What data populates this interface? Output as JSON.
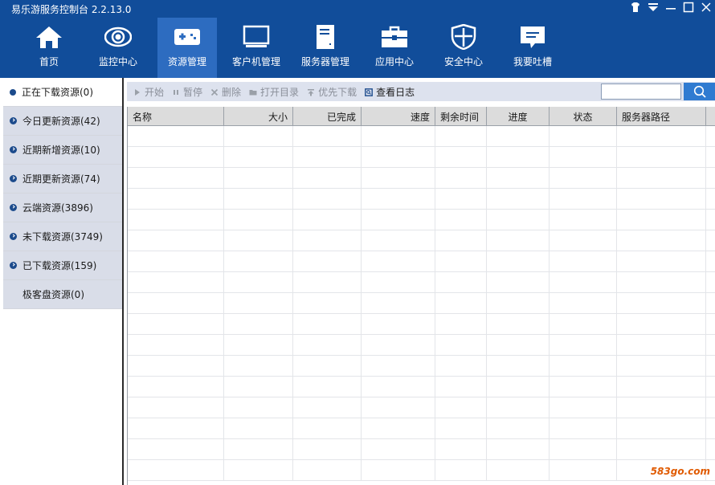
{
  "app": {
    "title": "易乐游服务控制台 2.2.13.0"
  },
  "colors": {
    "header_bg": "#114d9a",
    "nav_active_bg": "#2d6cc0",
    "sidebar_bg": "#d9dde8",
    "toolbar_bg": "#dde2ee",
    "search_button": "#2f7bd1"
  },
  "nav": {
    "items": [
      {
        "label": "首页",
        "icon": "home-icon"
      },
      {
        "label": "监控中心",
        "icon": "eye-icon"
      },
      {
        "label": "资源管理",
        "icon": "gamepad-icon",
        "active": true
      },
      {
        "label": "客户机管理",
        "icon": "monitor-icon"
      },
      {
        "label": "服务器管理",
        "icon": "server-icon"
      },
      {
        "label": "应用中心",
        "icon": "toolbox-icon"
      },
      {
        "label": "安全中心",
        "icon": "shield-icon"
      },
      {
        "label": "我要吐槽",
        "icon": "chat-bubble-icon"
      }
    ]
  },
  "sidebar": {
    "items": [
      {
        "label": "正在下载资源(0)",
        "active": true
      },
      {
        "label": "今日更新资源(42)"
      },
      {
        "label": "近期新增资源(10)"
      },
      {
        "label": "近期更新资源(74)"
      },
      {
        "label": "云端资源(3896)"
      },
      {
        "label": "未下载资源(3749)"
      },
      {
        "label": "已下载资源(159)"
      },
      {
        "label": "极客盘资源(0)",
        "plain": true
      }
    ]
  },
  "toolbar": {
    "start": "开始",
    "pause": "暂停",
    "delete": "删除",
    "open_dir": "打开目录",
    "priority": "优先下载",
    "view_log": "查看日志"
  },
  "search": {
    "value": "",
    "icon": "search-icon"
  },
  "table": {
    "columns": [
      "名称",
      "大小",
      "已完成",
      "速度",
      "剩余时间",
      "进度",
      "状态",
      "服务器路径"
    ],
    "rows": []
  },
  "watermark": {
    "text": "583go.com"
  }
}
